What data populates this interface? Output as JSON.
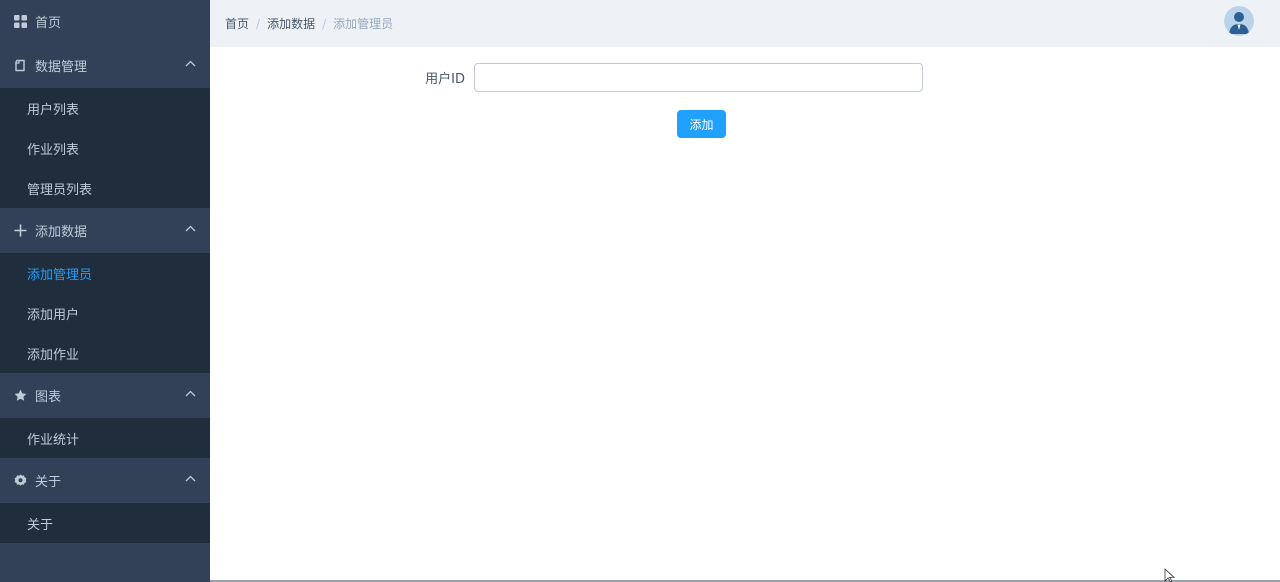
{
  "sidebar": {
    "home": {
      "label": "首页",
      "icon": "grid-icon"
    },
    "groups": [
      {
        "label": "数据管理",
        "icon": "document-icon",
        "expanded": true,
        "items": [
          {
            "label": "用户列表",
            "active": false
          },
          {
            "label": "作业列表",
            "active": false
          },
          {
            "label": "管理员列表",
            "active": false
          }
        ]
      },
      {
        "label": "添加数据",
        "icon": "plus-icon",
        "expanded": true,
        "items": [
          {
            "label": "添加管理员",
            "active": true
          },
          {
            "label": "添加用户",
            "active": false
          },
          {
            "label": "添加作业",
            "active": false
          }
        ]
      },
      {
        "label": "图表",
        "icon": "star-icon",
        "expanded": true,
        "items": [
          {
            "label": "作业统计",
            "active": false
          }
        ]
      },
      {
        "label": "关于",
        "icon": "gear-icon",
        "expanded": true,
        "items": [
          {
            "label": "关于",
            "active": false
          }
        ]
      }
    ]
  },
  "header": {
    "breadcrumb": [
      "首页",
      "添加数据",
      "添加管理员"
    ],
    "separator": "/"
  },
  "form": {
    "user_id_label": "用户ID",
    "user_id_value": "",
    "user_id_placeholder": "",
    "submit_label": "添加"
  },
  "colors": {
    "sidebar_bg": "#324157",
    "submenu_bg": "#1f2d3d",
    "sidebar_text": "#bfcbd9",
    "active": "#20a0ff",
    "header_bg": "#eef1f6",
    "primary_button": "#20a0ff"
  }
}
